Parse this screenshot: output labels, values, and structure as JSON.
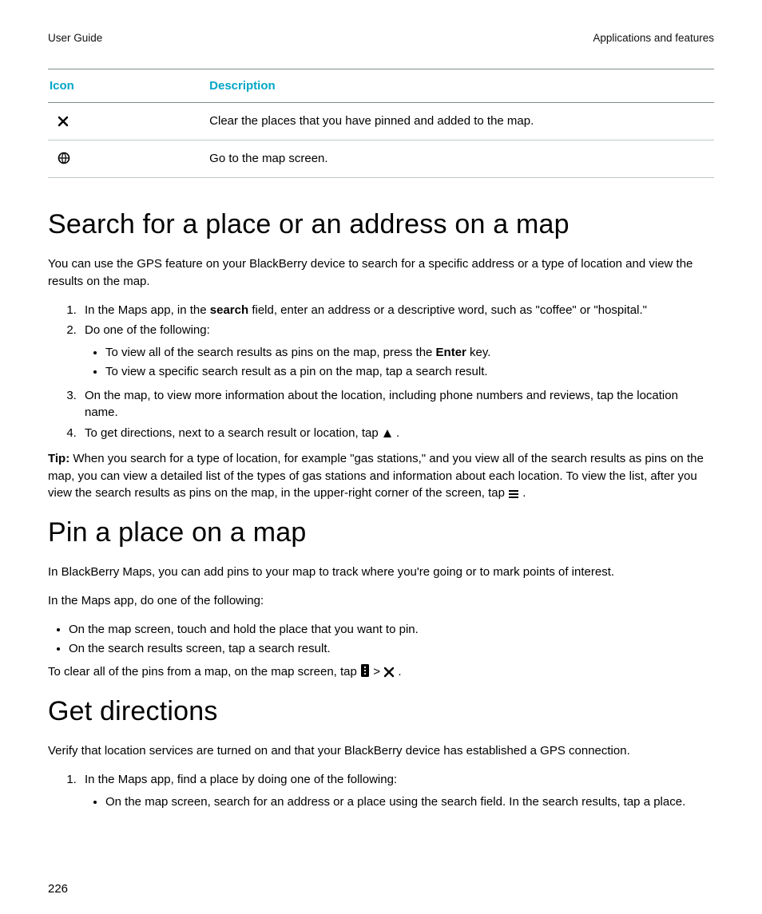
{
  "header": {
    "left": "User Guide",
    "right": "Applications and features"
  },
  "table": {
    "col_icon": "Icon",
    "col_desc": "Description",
    "rows": [
      {
        "icon_name": "close-icon",
        "desc": "Clear the places that you have pinned and added to the map."
      },
      {
        "icon_name": "globe-icon",
        "desc": "Go to the map screen."
      }
    ]
  },
  "s1": {
    "title": "Search for a place or an address on a map",
    "intro": "You can use the GPS feature on your BlackBerry device to search for a specific address or a type of location and view the results on the map.",
    "step1_a": "In the Maps app, in the ",
    "step1_b_bold": "search",
    "step1_c": " field, enter an address or a descriptive word, such as \"coffee\" or \"hospital.\"",
    "step2": "Do one of the following:",
    "step2_bullet1_a": "To view all of the search results as pins on the map, press the ",
    "step2_bullet1_b_bold": "Enter",
    "step2_bullet1_c": " key.",
    "step2_bullet2": "To view a specific search result as a pin on the map, tap a search result.",
    "step3": "On the map, to view more information about the location, including phone numbers and reviews, tap the location name.",
    "step4_a": "To get directions, next to a search result or location, tap ",
    "step4_b_icon": "triangle-up-icon",
    "step4_c": " .",
    "tip_label": "Tip: ",
    "tip_body_a": "When you search for a type of location, for example \"gas stations,\" and you view all of the search results as pins on the map, you can view a detailed list of the types of gas stations and information about each location. To view the list, after you view the search results as pins on the map, in the upper-right corner of the screen, tap ",
    "tip_icon": "menu-lines-icon",
    "tip_body_b": " ."
  },
  "s2": {
    "title": "Pin a place on a map",
    "intro": "In BlackBerry Maps, you can add pins to your map to track where you're going or to mark points of interest.",
    "lead": "In the Maps app, do one of the following:",
    "b1": "On the map screen, touch and hold the place that you want to pin.",
    "b2": "On the search results screen, tap a search result.",
    "clear_a": "To clear all of the pins from a map, on the map screen, tap ",
    "clear_icon1": "more-vert-icon",
    "clear_gt": " > ",
    "clear_icon2": "close-icon",
    "clear_b": " ."
  },
  "s3": {
    "title": "Get directions",
    "intro": "Verify that location services are turned on and that your BlackBerry device has established a GPS connection.",
    "step1": "In the Maps app, find a place by doing one of the following:",
    "step1_b1": "On the map screen, search for an address or a place using the search field. In the search results, tap a place."
  },
  "page_number": "226"
}
